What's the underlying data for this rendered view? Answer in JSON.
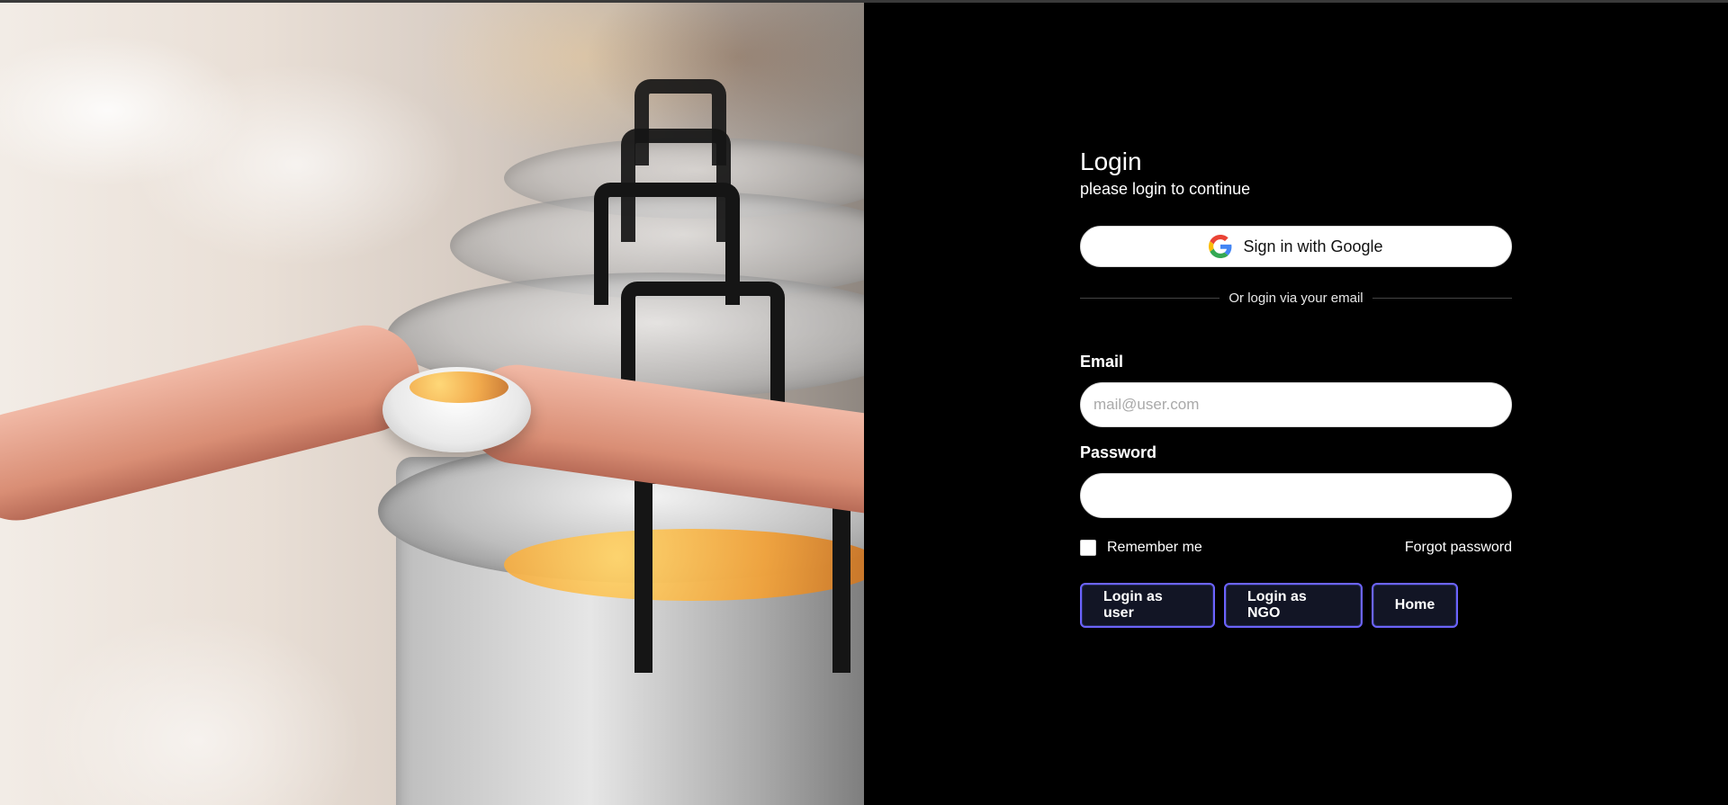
{
  "left_image": {
    "alt": "food being served from pots"
  },
  "login": {
    "title": "Login",
    "subtitle": "please login to continue",
    "google_button_label": "Sign in with Google",
    "divider_text": "Or login via your email",
    "email_label": "Email",
    "email_placeholder": "mail@user.com",
    "password_label": "Password",
    "remember_label": "Remember me",
    "forgot_password_label": "Forgot password",
    "buttons": {
      "login_user": "Login as user",
      "login_ngo": "Login as NGO",
      "home": "Home"
    }
  },
  "colors": {
    "background": "#000000",
    "button_bg": "#121525",
    "button_border": "#6c63ff",
    "input_bg": "#ffffff"
  },
  "icons": {
    "google": "google-icon"
  }
}
